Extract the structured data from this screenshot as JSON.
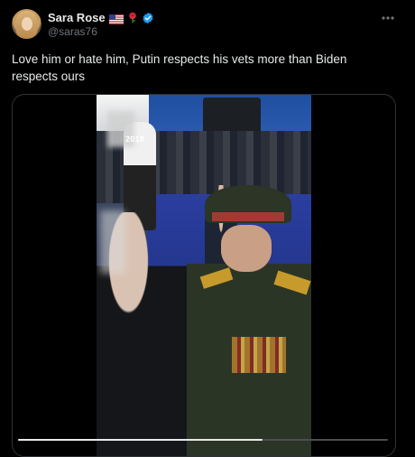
{
  "author": {
    "display_name": "Sara Rose",
    "handle": "@saras76",
    "badges": [
      "us-flag-icon",
      "rose-icon",
      "verified-icon"
    ]
  },
  "tweet": {
    "text": "Love him or hate him, Putin respects his vets more than Biden respects ours"
  },
  "media": {
    "type": "video",
    "overlay_text": "2018",
    "progress": 0.66
  },
  "colors": {
    "background": "#000000",
    "text_primary": "#e7e9ea",
    "text_secondary": "#71767b",
    "border": "#2f3336",
    "verified": "#1d9bf0"
  }
}
